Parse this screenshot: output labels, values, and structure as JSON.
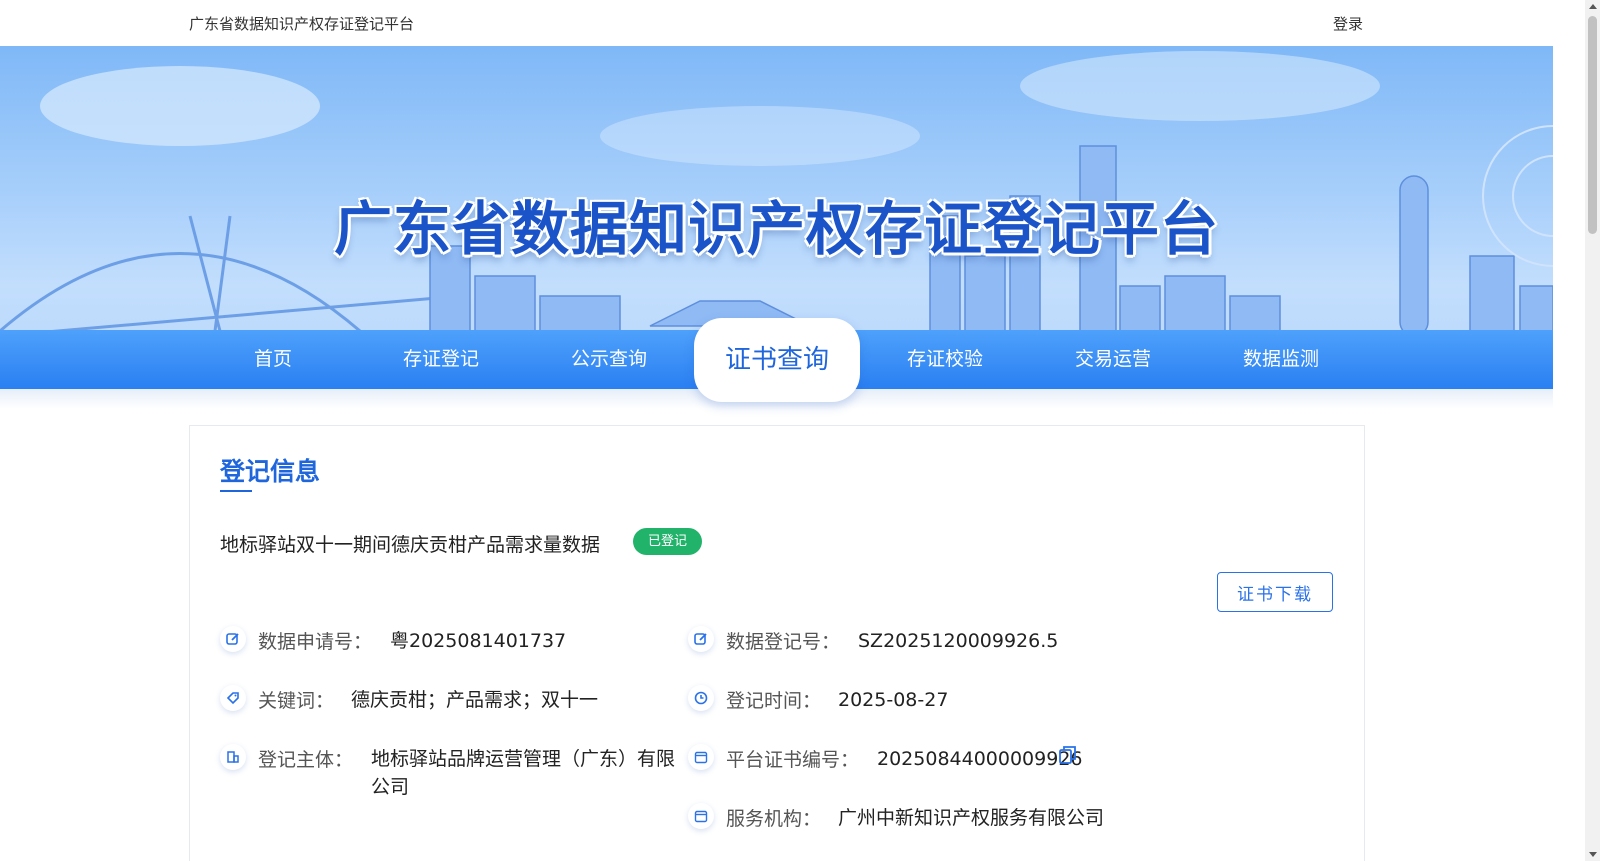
{
  "header": {
    "site_name": "广东省数据知识产权存证登记平台",
    "login_label": "登录"
  },
  "banner": {
    "title": "广东省数据知识产权存证登记平台"
  },
  "nav": {
    "items": [
      "首页",
      "存证登记",
      "公示查询",
      "证书查询",
      "存证校验",
      "交易运营",
      "数据监测"
    ],
    "active": "证书查询"
  },
  "card": {
    "section_title": "登记信息",
    "record_title": "地标驿站双十一期间德庆贡柑产品需求量数据",
    "status": "已登记",
    "download_label": "证书下载",
    "fields": {
      "application_no": {
        "label": "数据申请号：",
        "value": "粤2025081401737"
      },
      "registration_no": {
        "label": "数据登记号：",
        "value": "SZ2025120009926.5"
      },
      "keywords": {
        "label": "关键词：",
        "value": "德庆贡柑；产品需求；双十一"
      },
      "registration_time": {
        "label": "登记时间：",
        "value": "2025-08-27"
      },
      "registrant": {
        "label": "登记主体：",
        "value": "地标驿站品牌运营管理（广东）有限公司"
      },
      "certificate_no": {
        "label": "平台证书编号：",
        "value": "20250844000009926"
      },
      "service_org": {
        "label": "服务机构：",
        "value": "广州中新知识产权服务有限公司"
      }
    }
  },
  "colors": {
    "primary": "#1f66dd",
    "nav_bg": "#2a7ff2",
    "badge_green": "#22b36b"
  }
}
